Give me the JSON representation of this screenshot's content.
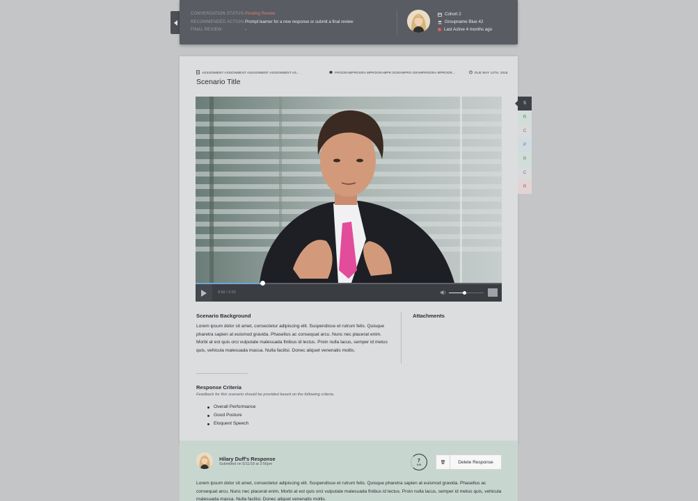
{
  "status": {
    "rows": [
      {
        "label": "CONVERSATION STATUS:",
        "value": "Pending Review",
        "kind": "pending"
      },
      {
        "label": "RECOMMENDED ACTION:",
        "value": "Prompt learner for a new response or submit a final review",
        "kind": "normal"
      },
      {
        "label": "FINAL REVIEW:",
        "value": "-",
        "kind": "normal"
      }
    ],
    "cohort": "Cohort 2",
    "group": "Groupname Blue 42",
    "last_active": "Last Active 4 months ago"
  },
  "crumbs": {
    "assignment": "ASSIGNMENT ASSIGNMENT ASSIGNMENT ASSIGNMENT AS...",
    "program": "PROGRAMPROGRA MPROGRAMPR OGRAMPRO GRAMPROGRA MPROGR...",
    "due": "DUE MAY 14TH, 2018"
  },
  "title": "Scenario Title",
  "video": {
    "time": "0:52 / 2:21",
    "progress": 0.22,
    "volume": 0.45
  },
  "side_tabs": [
    {
      "label": "S",
      "color": "#3d4046",
      "active": true
    },
    {
      "label": "R",
      "color": "#d1ddd7",
      "active": false
    },
    {
      "label": "C",
      "color": "#d9dadc",
      "active": false
    },
    {
      "label": "P",
      "color": "#cfdbe0",
      "active": false
    },
    {
      "label": "R",
      "color": "#d1ddd7",
      "active": false
    },
    {
      "label": "C",
      "color": "#d9dadc",
      "active": false
    },
    {
      "label": "R",
      "color": "#e3d3d3",
      "active": false
    }
  ],
  "background": {
    "heading": "Scenario Background",
    "text": "Lorem ipsum dolor sit amet, consectetur adipiscing elit. Suspendisse et rutrum felis. Quisque pharetra sapien at euismod gravida. Phasellus ac consequat arcu. Nunc nec placerat enim. Morbi at est quis orci vulputate malesuada finibus id lectus. Proin nulla lacus, semper id metus quis, vehicula malesuada massa. Nulla facilisi. Donec aliquet venenatis mollis."
  },
  "attachments": {
    "heading": "Attachments"
  },
  "criteria": {
    "heading": "Response Criteria",
    "hint": "Feedback for this scenario should be provided based on the following criteria.",
    "items": [
      "Overall Performance",
      "Good Posture",
      "Eloquent Speech"
    ]
  },
  "response": {
    "name": "Hilary Duff's Response",
    "submitted": "Submitted on 5/11/18 at 2:56pm",
    "timer_value": "7",
    "timer_unit": "MIN",
    "delete_label": "Delete Response",
    "text": "Lorem ipsum dolor sit amet, consectetur adipiscing elit. Suspendisse et rutrum felis. Quisque pharetra sapien at euismod gravida. Phasellus ac consequat arcu. Nunc nec placerat enim. Morbi at est quis orci vulputate malesuada finibus id lectus. Proin nulla lacus, semper id metus quis, vehicula malesuada massa. Nulla facilisi. Donec aliquet venenatis mollis."
  }
}
